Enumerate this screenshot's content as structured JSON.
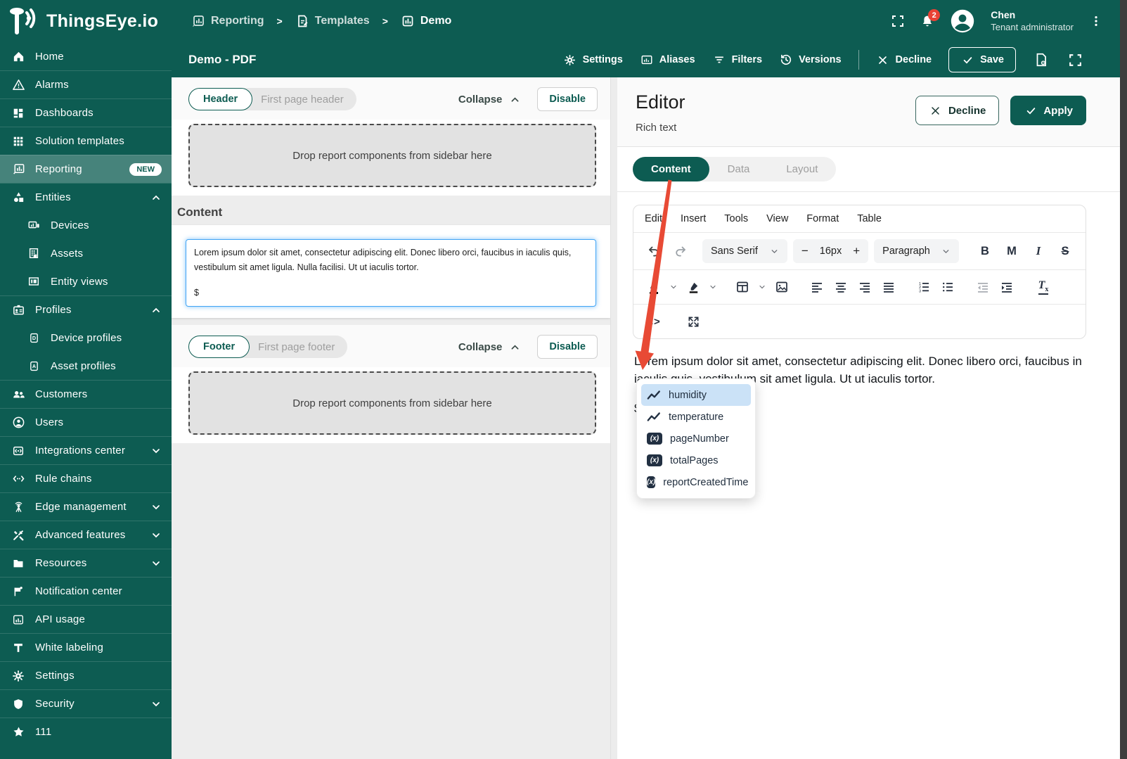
{
  "colors": {
    "primary": "#0d5c52",
    "badge_red": "#e94235",
    "arrow_red": "#e84a35",
    "autocomplete_highlight": "#cbe2f7",
    "input_focus_blue": "#42a5f5"
  },
  "topbar": {
    "brand": "ThingsEye.io",
    "breadcrumb": [
      {
        "label": "Reporting"
      },
      {
        "label": "Templates"
      },
      {
        "label": "Demo"
      }
    ],
    "notification_count": "2",
    "user": {
      "name": "Chen",
      "role": "Tenant administrator"
    }
  },
  "docbar": {
    "title": "Demo - PDF",
    "settings": "Settings",
    "aliases": "Aliases",
    "filters": "Filters",
    "versions": "Versions",
    "decline": "Decline",
    "save": "Save"
  },
  "sidebar": {
    "items": [
      {
        "label": "Home",
        "icon": "home-icon"
      },
      {
        "label": "Alarms",
        "icon": "alarms-icon"
      },
      {
        "label": "Dashboards",
        "icon": "dashboards-icon"
      },
      {
        "label": "Solution templates",
        "icon": "solution-templates-icon"
      },
      {
        "label": "Reporting",
        "icon": "reporting-icon",
        "badge": "NEW",
        "active": true
      },
      {
        "label": "Entities",
        "icon": "entities-icon",
        "chevron": "up"
      },
      {
        "label": "Devices",
        "icon": "devices-icon",
        "sub": true
      },
      {
        "label": "Assets",
        "icon": "assets-icon",
        "sub": true
      },
      {
        "label": "Entity views",
        "icon": "entity-views-icon",
        "sub": true
      },
      {
        "label": "Profiles",
        "icon": "profiles-icon",
        "chevron": "up"
      },
      {
        "label": "Device profiles",
        "icon": "device-profiles-icon",
        "sub": true
      },
      {
        "label": "Asset profiles",
        "icon": "asset-profiles-icon",
        "sub": true
      },
      {
        "label": "Customers",
        "icon": "customers-icon"
      },
      {
        "label": "Users",
        "icon": "users-icon"
      },
      {
        "label": "Integrations center",
        "icon": "integrations-icon",
        "chevron": "down"
      },
      {
        "label": "Rule chains",
        "icon": "rule-chains-icon"
      },
      {
        "label": "Edge management",
        "icon": "edge-icon",
        "chevron": "down"
      },
      {
        "label": "Advanced features",
        "icon": "advanced-icon",
        "chevron": "down"
      },
      {
        "label": "Resources",
        "icon": "resources-icon",
        "chevron": "down"
      },
      {
        "label": "Notification center",
        "icon": "notification-icon"
      },
      {
        "label": "API usage",
        "icon": "api-usage-icon"
      },
      {
        "label": "White labeling",
        "icon": "white-labeling-icon"
      },
      {
        "label": "Settings",
        "icon": "settings-icon"
      },
      {
        "label": "Security",
        "icon": "security-icon",
        "chevron": "down"
      },
      {
        "label": "111",
        "icon": "star-icon"
      }
    ]
  },
  "report": {
    "header_section": {
      "chip": "Header",
      "chip_secondary": "First page header",
      "collapse": "Collapse",
      "disable": "Disable",
      "dropzone": "Drop report components from sidebar here"
    },
    "content_section": {
      "title": "Content",
      "text": "Lorem ipsum dolor sit amet, consectetur adipiscing elit. Donec libero orci, faucibus in iaculis quis, vestibulum sit amet ligula. Nulla facilisi. Ut ut iaculis tortor.",
      "token": "$"
    },
    "footer_section": {
      "chip": "Footer",
      "chip_secondary": "First page footer",
      "collapse": "Collapse",
      "disable": "Disable",
      "dropzone": "Drop report components from sidebar here"
    }
  },
  "editor": {
    "title": "Editor",
    "subtitle": "Rich text",
    "decline": "Decline",
    "apply": "Apply",
    "tabs": [
      "Content",
      "Data",
      "Layout"
    ],
    "active_tab": "Content",
    "menu": [
      "Edit",
      "Insert",
      "Tools",
      "View",
      "Format",
      "Table"
    ],
    "toolbar": {
      "font_family": "Sans Serif",
      "font_size": "16px",
      "block_format": "Paragraph",
      "bold": "B",
      "merge_tag": "M",
      "italic": "I",
      "strikethrough": "S"
    },
    "content_text": "Lorem ipsum dolor sit amet, consectetur adipiscing elit. Donec libero orci, faucibus in iaculis quis, vestibulum sit amet ligula. Ut ut iaculis tortor.",
    "content_text_full": "Lorem ipsum dolor sit amet, consectetur adipiscing elit. Donec libero orci, faucibus in iaculis quis, vestibulum sit amet ligula. Nulla facilisi. Ut ut iaculis tortor.",
    "token": "$",
    "autocomplete": [
      {
        "label": "humidity",
        "icon": "timeseries-icon",
        "selected": true
      },
      {
        "label": "temperature",
        "icon": "timeseries-icon"
      },
      {
        "label": "pageNumber",
        "icon": "function-icon"
      },
      {
        "label": "totalPages",
        "icon": "function-icon"
      },
      {
        "label": "reportCreatedTime",
        "icon": "function-icon"
      }
    ]
  }
}
